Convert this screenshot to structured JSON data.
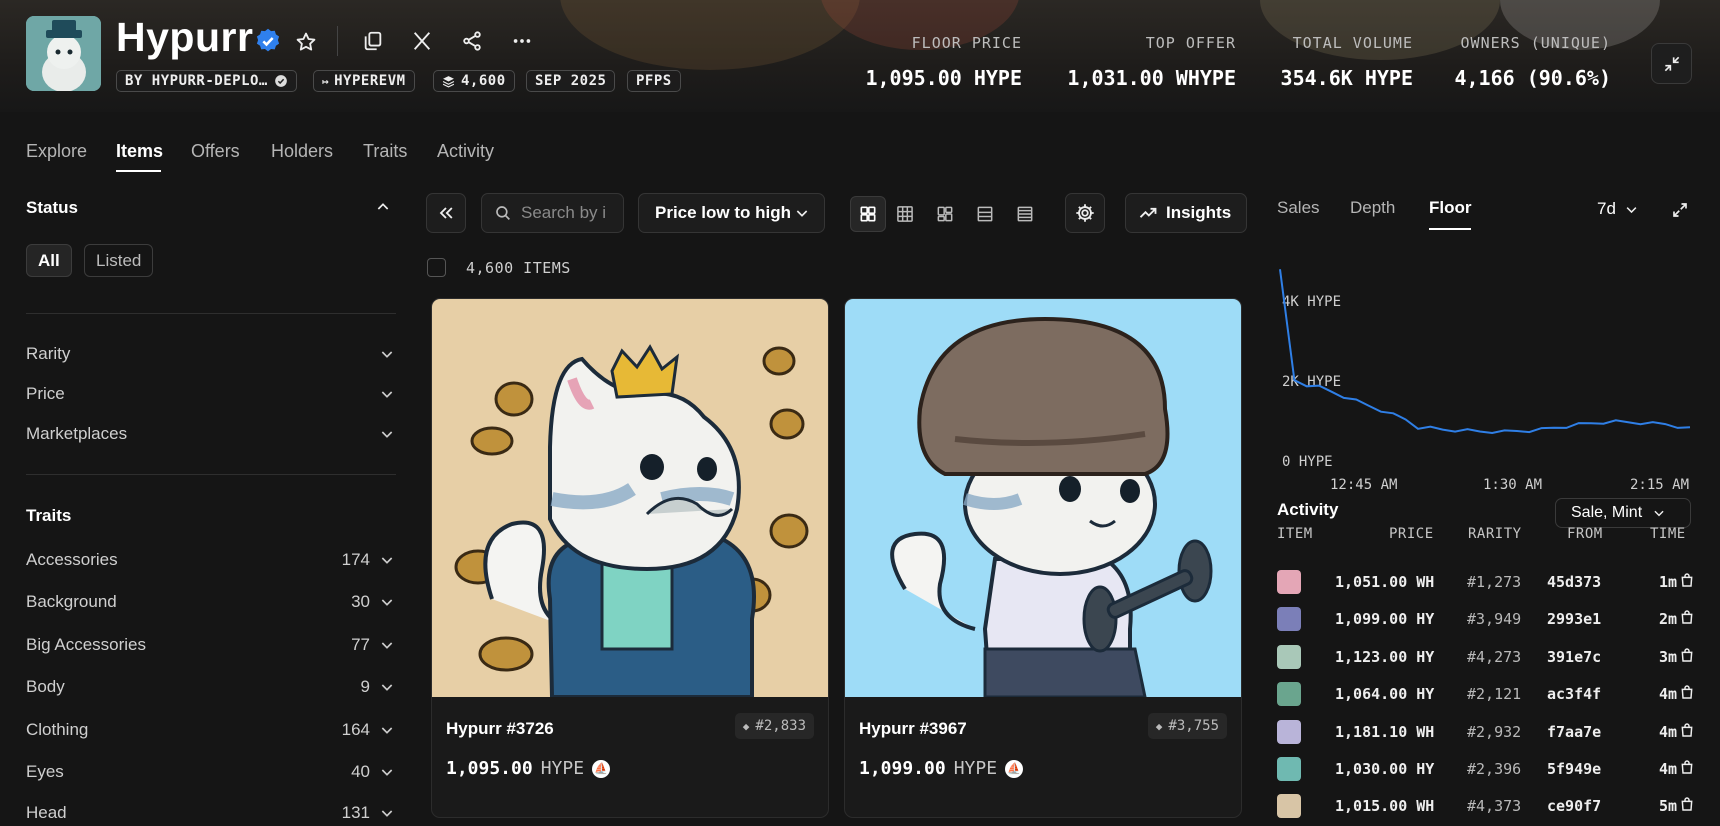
{
  "collection": {
    "name": "Hypurr",
    "creator": "BY HYPURR-DEPLO…",
    "chain": "HYPEREVM",
    "supply": "4,600",
    "date": "SEP 2025",
    "category": "PFPS"
  },
  "stats": [
    {
      "label": "FLOOR PRICE",
      "value": "1,095.00 HYPE"
    },
    {
      "label": "TOP OFFER",
      "value": "1,031.00 WHYPE"
    },
    {
      "label": "TOTAL VOLUME",
      "value": "354.6K HYPE"
    },
    {
      "label": "OWNERS (UNIQUE)",
      "value": "4,166 (90.6%)"
    }
  ],
  "nav_tabs": [
    "Explore",
    "Items",
    "Offers",
    "Holders",
    "Traits",
    "Activity"
  ],
  "sidebar": {
    "status_title": "Status",
    "status_pills": [
      "All",
      "Listed"
    ],
    "filters": [
      "Rarity",
      "Price",
      "Marketplaces"
    ],
    "traits_title": "Traits",
    "traits": [
      {
        "name": "Accessories",
        "count": "174"
      },
      {
        "name": "Background",
        "count": "30"
      },
      {
        "name": "Big Accessories",
        "count": "77"
      },
      {
        "name": "Body",
        "count": "9"
      },
      {
        "name": "Clothing",
        "count": "164"
      },
      {
        "name": "Eyes",
        "count": "40"
      },
      {
        "name": "Head",
        "count": "131"
      }
    ]
  },
  "toolbar": {
    "search_placeholder": "Search by i",
    "sort_label": "Price low to high",
    "insights_label": "Insights",
    "items_count": "4,600 ITEMS"
  },
  "items": [
    {
      "name": "Hypurr #3726",
      "rank": "#2,833",
      "price": "1,095.00",
      "unit": "HYPE",
      "bg": "#e7cfa6"
    },
    {
      "name": "Hypurr #3967",
      "rank": "#3,755",
      "price": "1,099.00",
      "unit": "HYPE",
      "bg": "#9edcf7"
    }
  ],
  "chart_panel": {
    "tabs": [
      "Sales",
      "Depth",
      "Floor"
    ],
    "active_tab": "Floor",
    "range": "7d"
  },
  "chart_data": {
    "type": "line",
    "title": "",
    "series": [
      {
        "values": [
          4300,
          1900,
          1800,
          1750,
          1650,
          1550,
          1450,
          1350,
          1250,
          1150,
          1050,
          880,
          860,
          830,
          820,
          810,
          790,
          790,
          780,
          800,
          810,
          830,
          870,
          900,
          940,
          970,
          990,
          1000,
          990,
          980,
          960,
          950,
          900,
          880
        ]
      }
    ],
    "y_ticks": [
      "4K HYPE",
      "2K HYPE",
      "0 HYPE"
    ],
    "x_ticks": [
      "12:45 AM",
      "1:30 AM",
      "2:15 AM"
    ],
    "ylim": [
      0,
      4500
    ],
    "grid": false
  },
  "activity": {
    "title": "Activity",
    "filter": "Sale, Mint",
    "columns": [
      "ITEM",
      "PRICE",
      "RARITY",
      "FROM",
      "TIME"
    ],
    "rows": [
      {
        "price": "1,051.00 WH",
        "rarity": "#1,273",
        "from": "45d373",
        "time": "1m",
        "color": "#e4a6b6"
      },
      {
        "price": "1,099.00 HY",
        "rarity": "#3,949",
        "from": "2993e1",
        "time": "2m",
        "color": "#7b7fb8"
      },
      {
        "price": "1,123.00 HY",
        "rarity": "#4,273",
        "from": "391e7c",
        "time": "3m",
        "color": "#a9c8b8"
      },
      {
        "price": "1,064.00 HY",
        "rarity": "#2,121",
        "from": "ac3f4f",
        "time": "4m",
        "color": "#6aa58e"
      },
      {
        "price": "1,181.10 WH",
        "rarity": "#2,932",
        "from": "f7aa7e",
        "time": "4m",
        "color": "#b9b4d9"
      },
      {
        "price": "1,030.00 HY",
        "rarity": "#2,396",
        "from": "5f949e",
        "time": "4m",
        "color": "#6fb9b1"
      },
      {
        "price": "1,015.00 WH",
        "rarity": "#4,373",
        "from": "ce90f7",
        "time": "5m",
        "color": "#d8c5a6"
      }
    ]
  },
  "colors": {
    "accent_blue": "#2f7fe6",
    "verified": "#2f80ed",
    "background": "#151515"
  }
}
